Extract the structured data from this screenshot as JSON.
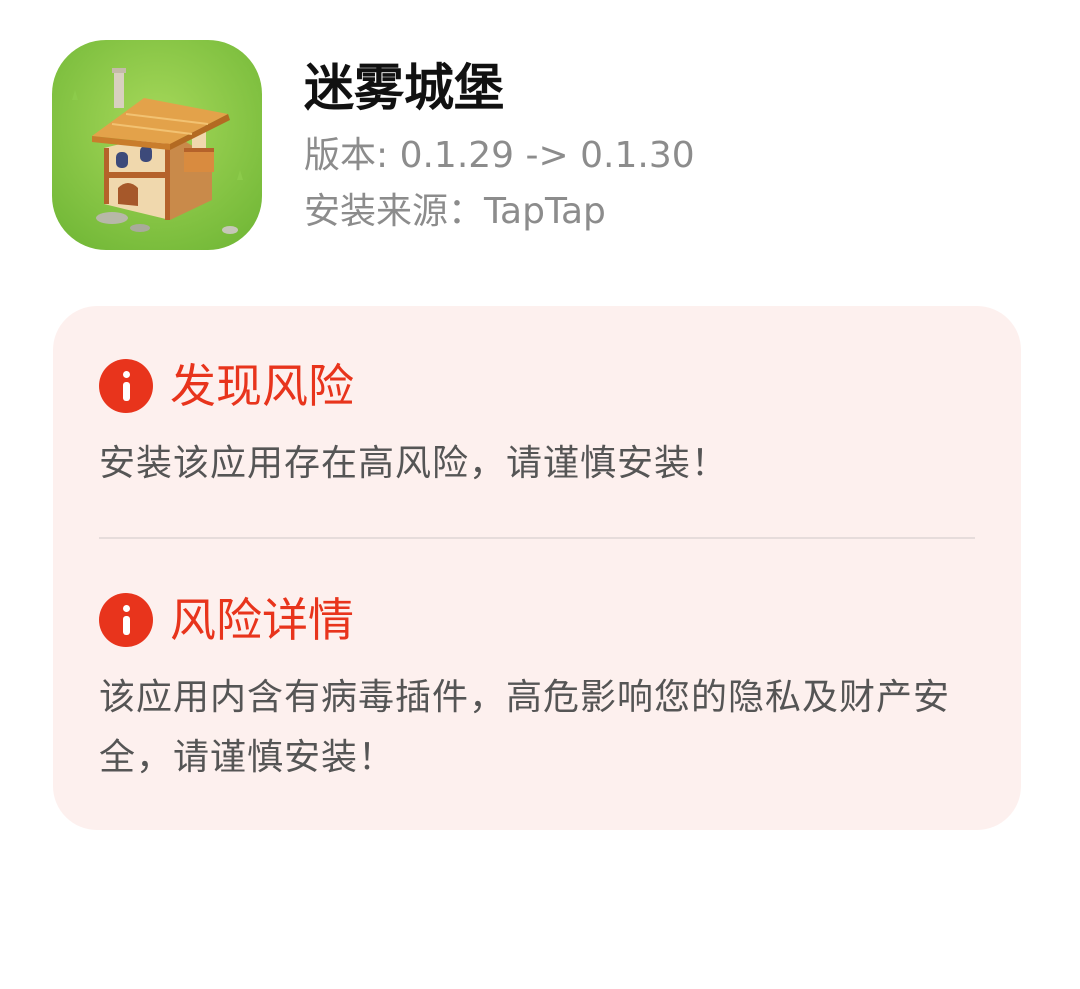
{
  "app": {
    "name": "迷雾城堡",
    "version_line": "版本: 0.1.29 -> 0.1.30",
    "source_line": "安装来源：TapTap",
    "icon": "castle-house-game-icon"
  },
  "risk": {
    "found": {
      "icon": "info-alert-icon",
      "title": "发现风险",
      "text": "安装该应用存在高风险，请谨慎安装！"
    },
    "details": {
      "icon": "info-alert-icon",
      "title": "风险详情",
      "text": "该应用内含有病毒插件，高危影响您的隐私及财产安全，请谨慎安装！"
    }
  },
  "colors": {
    "accent_red": "#e8341c",
    "card_background": "#fdf0ee",
    "title_text": "#111111",
    "meta_text": "#8c8c8c",
    "body_text": "#555555"
  }
}
